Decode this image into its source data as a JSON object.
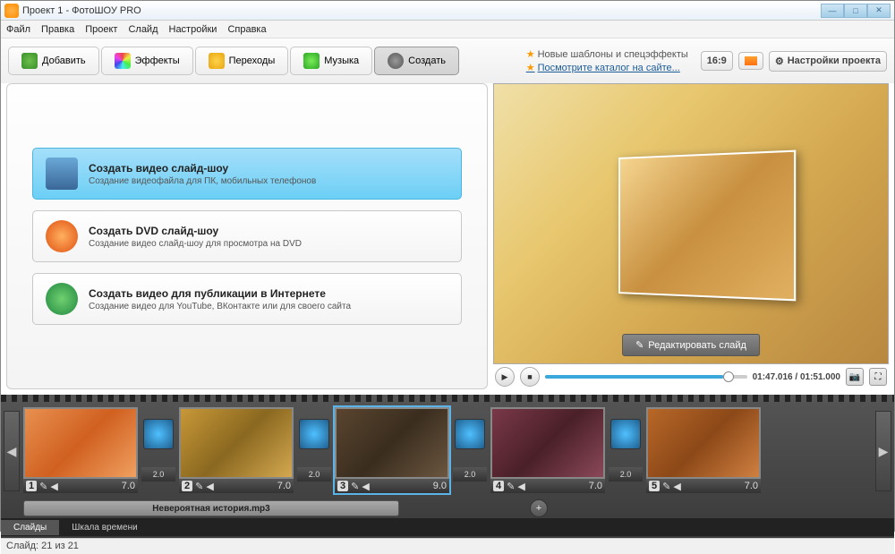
{
  "window": {
    "title": "Проект 1 - ФотоШОУ PRO"
  },
  "menu": {
    "file": "Файл",
    "edit": "Правка",
    "project": "Проект",
    "slide": "Слайд",
    "settings": "Настройки",
    "help": "Справка"
  },
  "tabs": {
    "add": "Добавить",
    "effects": "Эффекты",
    "transitions": "Переходы",
    "music": "Музыка",
    "create": "Создать"
  },
  "info": {
    "line1": "Новые шаблоны и спецэффекты",
    "line2": "Посмотрите каталог на сайте..."
  },
  "tools": {
    "ratio": "16:9",
    "settings": "Настройки проекта"
  },
  "options": [
    {
      "title": "Создать видео слайд-шоу",
      "desc": "Создание видеофайла для ПК, мобильных телефонов"
    },
    {
      "title": "Создать DVD слайд-шоу",
      "desc": "Создание видео слайд-шоу для просмотра на DVD"
    },
    {
      "title": "Создать видео для публикации в Интернете",
      "desc": "Создание видео для YouTube, ВКонтакте или для своего сайта"
    }
  ],
  "preview": {
    "edit": "Редактировать слайд",
    "time": "01:47.016 / 01:51.000"
  },
  "slides": [
    {
      "num": "1",
      "dur": "7.0",
      "trans": "2.0"
    },
    {
      "num": "2",
      "dur": "7.0",
      "trans": "2.0"
    },
    {
      "num": "3",
      "dur": "9.0",
      "trans": "2.0"
    },
    {
      "num": "4",
      "dur": "7.0",
      "trans": "2.0"
    },
    {
      "num": "5",
      "dur": "7.0",
      "trans": ""
    }
  ],
  "audio": {
    "clip": "Невероятная история.mp3"
  },
  "views": {
    "slides": "Слайды",
    "timeline": "Шкала времени"
  },
  "status": {
    "text": "Слайд: 21 из 21"
  }
}
